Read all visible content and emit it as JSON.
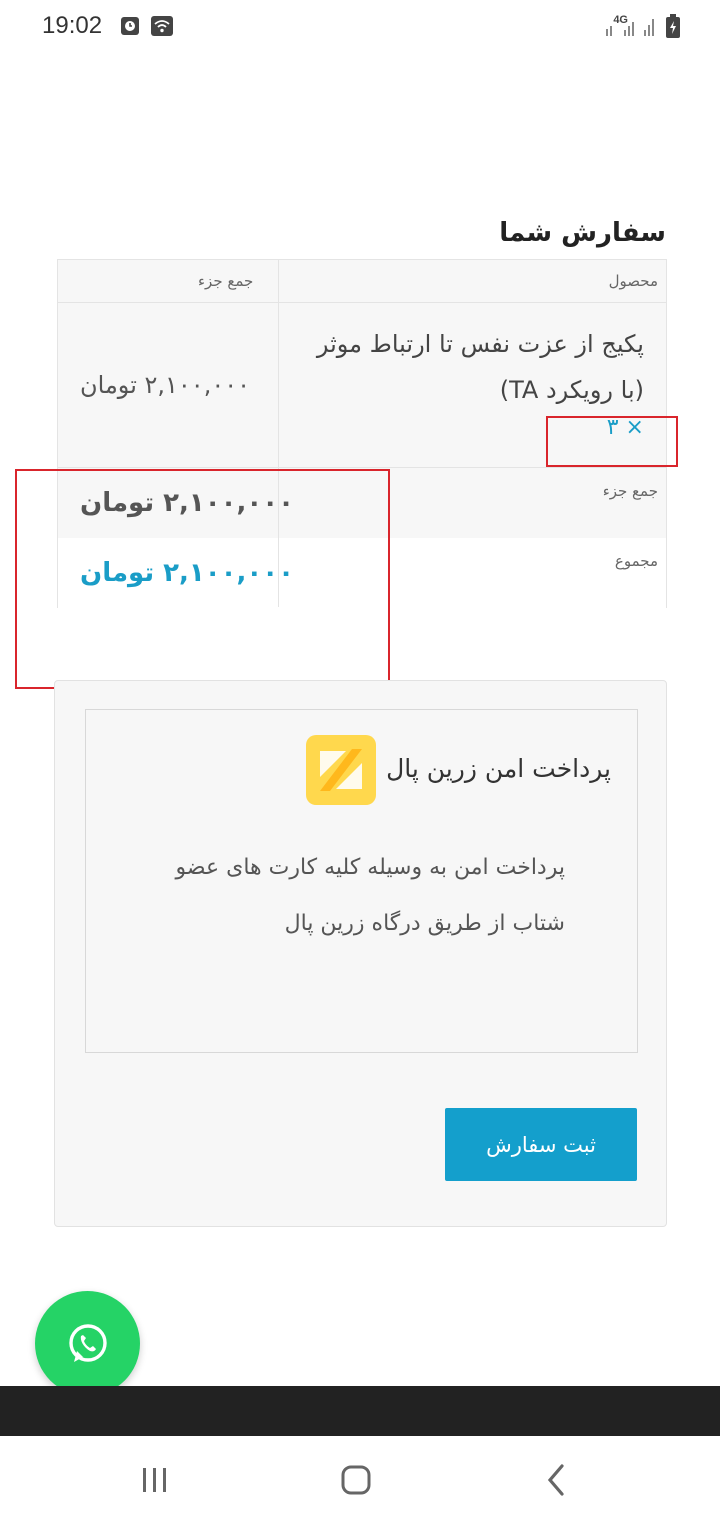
{
  "status_bar": {
    "time": "19:02",
    "network": "4G"
  },
  "order": {
    "title": "سفارش شما",
    "header_product": "محصول",
    "header_subtotal": "جمع جزء",
    "product_name": "پکیج از عزت نفس تا ارتباط موثر (با رویکرد TA)",
    "product_qty": "× ۳",
    "product_price": "۲,۱۰۰,۰۰۰ تومان",
    "subtotal_label": "جمع جزء",
    "subtotal_value": "۲,۱۰۰,۰۰۰ تومان",
    "total_label": "مجموع",
    "total_value": "۲,۱۰۰,۰۰۰ تومان"
  },
  "payment": {
    "method_title": "پرداخت امن زرین پال",
    "description": "پرداخت امن به وسیله کلیه کارت های عضو شتاب از طریق درگاه زرین پال",
    "submit_label": "ثبت سفارش"
  },
  "colors": {
    "accent": "#149fcc",
    "total_text": "#1a9dc7",
    "annotation": "#d9252c",
    "whatsapp": "#25d366",
    "zarinpal_logo": "#ffd84d"
  },
  "icons": [
    "alarm-icon",
    "wifi-icon",
    "signal-icon",
    "battery-icon",
    "zarinpal-logo-icon",
    "whatsapp-icon",
    "recent-apps-icon",
    "home-icon",
    "back-icon"
  ]
}
